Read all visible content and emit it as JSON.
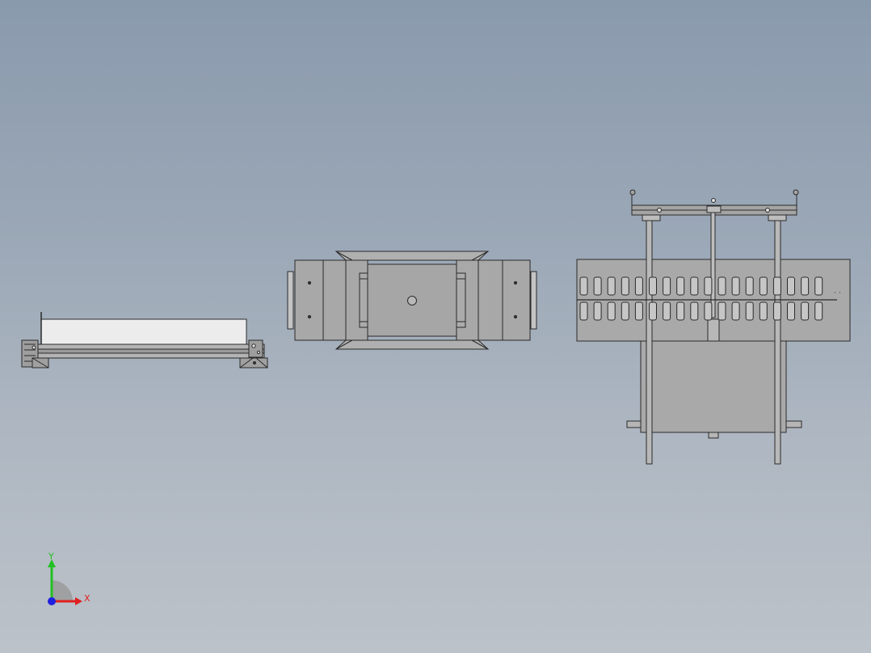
{
  "viewport": {
    "background_top": "#8a9aad",
    "background_bottom": "#bcc2c9"
  },
  "model": {
    "body_color": "#a9a9a9",
    "edge_color": "#2a2a2a",
    "panel_color": "#ececec"
  },
  "triad": {
    "x_label": "X",
    "y_label": "Y",
    "x_color": "#e02020",
    "y_color": "#22c022",
    "z_color": "#2020e0"
  }
}
